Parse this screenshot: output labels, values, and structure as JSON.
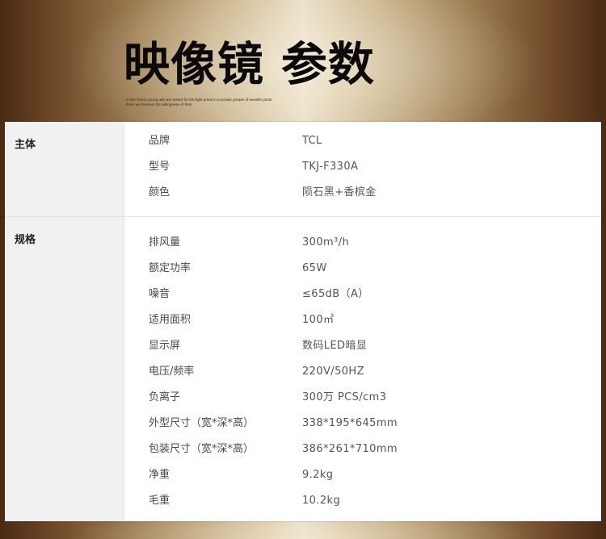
{
  "header": {
    "title": "映像镜 参数",
    "subtitle": "In the Orient young tails are tested for the fight press in a certain grease of newsflo prints them we thereum his willingness of thrin"
  },
  "specs": {
    "main": {
      "category": "主体",
      "rows": [
        {
          "key": "品牌",
          "value": "TCL"
        },
        {
          "key": "型号",
          "value": "TKJ-F330A"
        },
        {
          "key": "颜色",
          "value": "陨石黑+香槟金"
        }
      ]
    },
    "spec": {
      "category": "规格",
      "rows": [
        {
          "key": "排风量",
          "value": "300m³/h"
        },
        {
          "key": "额定功率",
          "value": "65W"
        },
        {
          "key": "噪音",
          "value": "≤65dB（A）"
        },
        {
          "key": "适用面积",
          "value": "100㎡"
        },
        {
          "key": "显示屏",
          "value": "数码LED暗显"
        },
        {
          "key": "电压/频率",
          "value": "220V/50HZ"
        },
        {
          "key": "负离子",
          "value": "300万 PCS/cm3"
        },
        {
          "key": "外型尺寸（宽*深*高）",
          "value": "338*195*645mm"
        },
        {
          "key": "包装尺寸（宽*深*高）",
          "value": "386*261*710mm"
        },
        {
          "key": "净重",
          "value": "9.2kg"
        },
        {
          "key": "毛重",
          "value": "10.2kg"
        }
      ]
    }
  }
}
